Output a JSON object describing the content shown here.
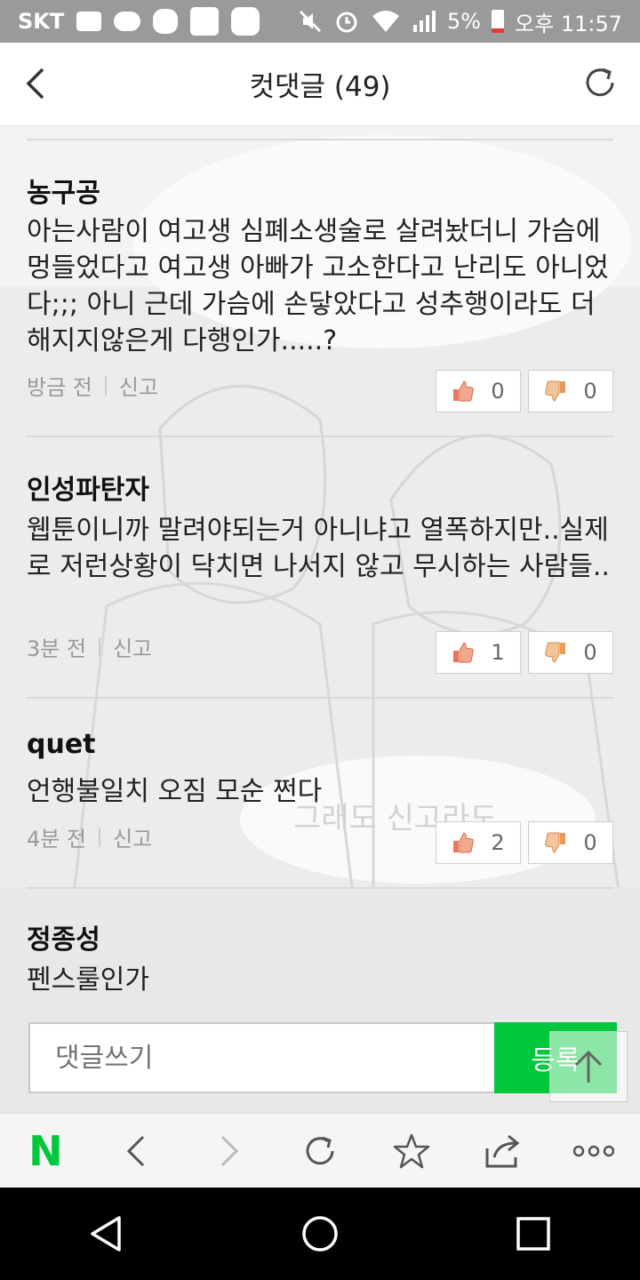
{
  "status_bar": {
    "carrier": "SKT",
    "battery": "5%",
    "time": "오후 11:57"
  },
  "header": {
    "title": "컷댓글 (49)"
  },
  "comments": [
    {
      "author": "농구공",
      "text": "아는사람이 여고생 심폐소생술로 살려놨더니 가슴에 멍들었다고 여고생 아빠가 고소한다고 난리도 아니었다;;; 아니 근데 가슴에 손닿았다고 성추행이라도 더해지지않은게 다행인가.....?",
      "time": "방금 전",
      "report": "신고",
      "likes": "0",
      "dislikes": "0"
    },
    {
      "author": "인성파탄자",
      "text": "웹툰이니까 말려야되는거 아니냐고 열폭하지만..실제로 저런상황이 닥치면 나서지 않고 무시하는 사람들..",
      "time": "3분 전",
      "report": "신고",
      "likes": "1",
      "dislikes": "0"
    },
    {
      "author": "quet",
      "text": "언행불일치 오짐 모순 쩐다",
      "time": "4분 전",
      "report": "신고",
      "likes": "2",
      "dislikes": "0"
    },
    {
      "author": "정종성",
      "text": "펜스룰인가"
    }
  ],
  "background_speech": {
    "bubble_bottom": "그래도 신고라도"
  },
  "composer": {
    "placeholder": "댓글쓰기",
    "submit_label": "등록"
  },
  "toolbar": {
    "logo": "N"
  },
  "colors": {
    "accent": "#00c73c",
    "like": "#e8785a",
    "dislike": "#e89a5a"
  }
}
